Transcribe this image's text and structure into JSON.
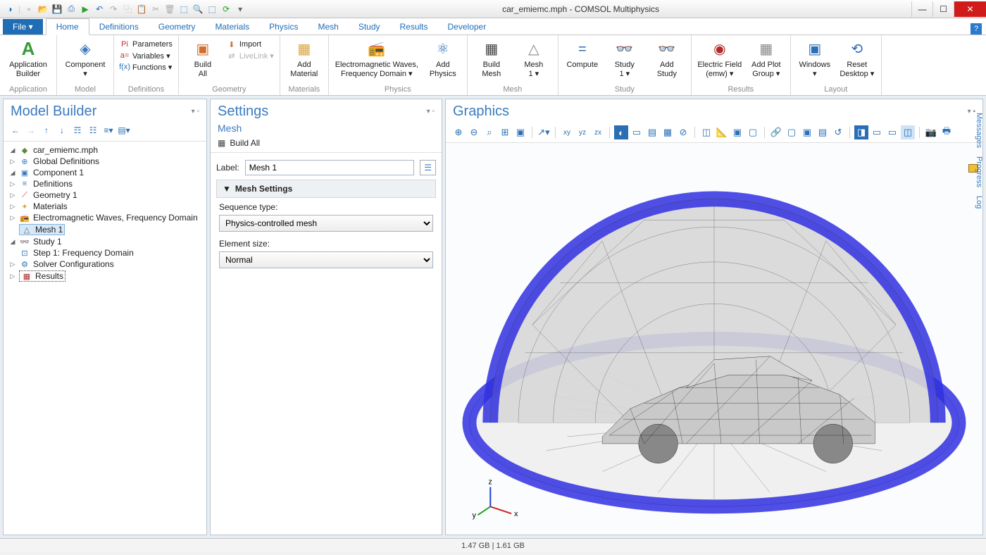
{
  "window": {
    "title": "car_emiemc.mph - COMSOL Multiphysics"
  },
  "ribbon": {
    "file": "File ▾",
    "tabs": [
      "Home",
      "Definitions",
      "Geometry",
      "Materials",
      "Physics",
      "Mesh",
      "Study",
      "Results",
      "Developer"
    ],
    "active_tab": 0,
    "groups": {
      "application": {
        "label": "Application",
        "app_builder": "Application\nBuilder"
      },
      "model": {
        "label": "Model",
        "component": "Component\n▾"
      },
      "definitions": {
        "label": "Definitions",
        "parameters": "Parameters",
        "variables": "Variables ▾",
        "functions": "Functions ▾"
      },
      "geometry": {
        "label": "Geometry",
        "build_all": "Build\nAll",
        "import": "Import",
        "livelink": "LiveLink ▾"
      },
      "materials": {
        "label": "Materials",
        "add_material": "Add\nMaterial"
      },
      "physics": {
        "label": "Physics",
        "emw": "Electromagnetic Waves,\nFrequency Domain ▾",
        "add_physics": "Add\nPhysics"
      },
      "mesh": {
        "label": "Mesh",
        "build_mesh": "Build\nMesh",
        "mesh1": "Mesh\n1 ▾"
      },
      "study": {
        "label": "Study",
        "compute": "Compute",
        "study1": "Study\n1 ▾",
        "add_study": "Add\nStudy"
      },
      "results": {
        "label": "Results",
        "efield": "Electric Field\n(emw) ▾",
        "add_plot": "Add Plot\nGroup ▾"
      },
      "layout": {
        "label": "Layout",
        "windows": "Windows\n▾",
        "reset": "Reset\nDesktop ▾"
      }
    }
  },
  "model_builder": {
    "title": "Model Builder",
    "root": "car_emiemc.mph",
    "items": {
      "global": "Global Definitions",
      "component": "Component 1",
      "definitions": "Definitions",
      "geometry": "Geometry 1",
      "materials": "Materials",
      "emw": "Electromagnetic Waves, Frequency Domain",
      "mesh": "Mesh 1",
      "study": "Study 1",
      "step1": "Step 1: Frequency Domain",
      "solver": "Solver Configurations",
      "results": "Results"
    }
  },
  "settings": {
    "title": "Settings",
    "subtitle": "Mesh",
    "build_all": "Build All",
    "label_caption": "Label:",
    "label_value": "Mesh 1",
    "section": "Mesh Settings",
    "seq_type_label": "Sequence type:",
    "seq_type_value": "Physics-controlled mesh",
    "elem_size_label": "Element size:",
    "elem_size_value": "Normal"
  },
  "graphics": {
    "title": "Graphics",
    "axes": {
      "x": "x",
      "y": "y",
      "z": "z"
    }
  },
  "right_tabs": [
    "Messages",
    "Progress",
    "Log"
  ],
  "status": "1.47 GB | 1.61 GB"
}
